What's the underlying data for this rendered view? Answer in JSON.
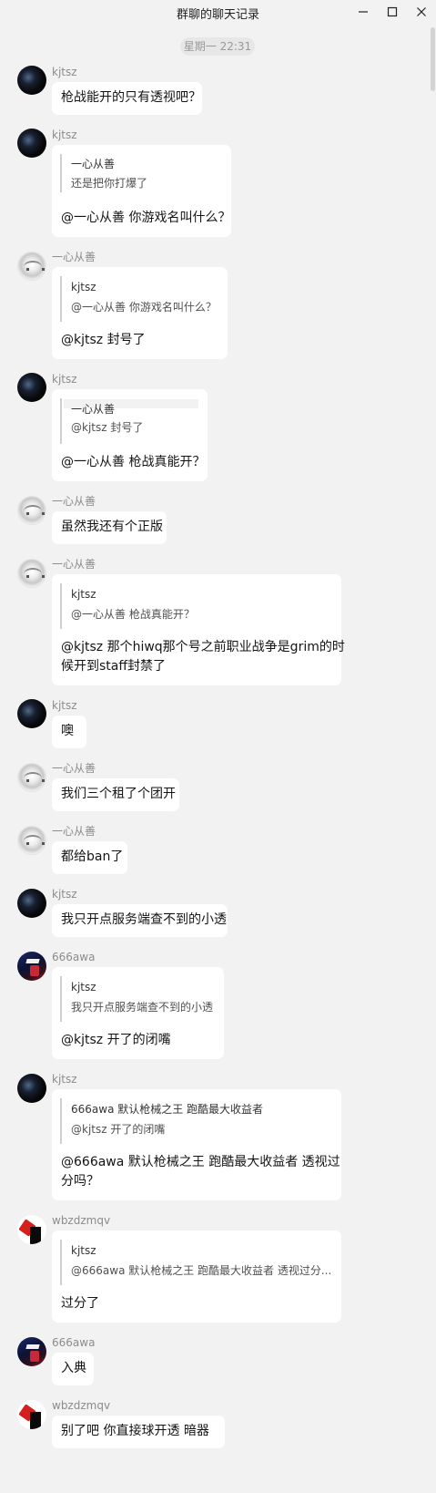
{
  "window": {
    "title": "群聊的聊天记录",
    "minimize_glyph": "minimize-icon",
    "maximize_glyph": "maximize-icon",
    "close_glyph": "close-icon"
  },
  "timestamp": "星期一 22:31",
  "messages": [
    {
      "sender": "kjtsz",
      "avatar": "dark-space-avatar",
      "text": "枪战能开的只有透视吧？"
    },
    {
      "sender": "kjtsz",
      "avatar": "dark-space-avatar",
      "quote": {
        "author": "一心从善",
        "text": "还是把你打爆了"
      },
      "text": "@一心从善 你游戏名叫什么？"
    },
    {
      "sender": "一心从善",
      "avatar": "anime-avatar",
      "quote": {
        "author": "kjtsz",
        "text": "@一心从善 你游戏名叫什么？"
      },
      "text": "@kjtsz 封号了"
    },
    {
      "sender": "kjtsz",
      "avatar": "dark-space-avatar",
      "quote": {
        "author": "一心从善",
        "text": "@kjtsz 封号了"
      },
      "text": "@一心从善 枪战真能开？"
    },
    {
      "sender": "一心从善",
      "avatar": "anime-avatar",
      "text": "虽然我还有个正版"
    },
    {
      "sender": "一心从善",
      "avatar": "anime-avatar",
      "quote": {
        "author": "kjtsz",
        "text": "@一心从善 枪战真能开？"
      },
      "text_lines": [
        "@kjtsz 那个hiwq那个号之前职业战争是grim的时",
        "候开到staff封禁了"
      ]
    },
    {
      "sender": "kjtsz",
      "avatar": "dark-space-avatar",
      "text": "噢"
    },
    {
      "sender": "一心从善",
      "avatar": "anime-avatar",
      "text": "我们三个租了个团开"
    },
    {
      "sender": "一心从善",
      "avatar": "anime-avatar",
      "text": "都给ban了"
    },
    {
      "sender": "kjtsz",
      "avatar": "dark-space-avatar",
      "text": "我只开点服务端查不到的小透"
    },
    {
      "sender": "666awa",
      "avatar": "game-avatar",
      "quote": {
        "author": "kjtsz",
        "text": "我只开点服务端查不到的小透"
      },
      "text": "@kjtsz 开了的闭嘴"
    },
    {
      "sender": "kjtsz",
      "avatar": "dark-space-avatar",
      "quote": {
        "author": "666awa 默认枪械之王 跑酷最大收益者",
        "text": "@kjtsz 开了的闭嘴"
      },
      "text_lines": [
        "@666awa 默认枪械之王 跑酷最大收益者 透视过",
        "分吗？"
      ]
    },
    {
      "sender": "wbzdzmqv",
      "avatar": "red-black-avatar",
      "quote": {
        "author": "kjtsz",
        "text": "@666awa 默认枪械之王 跑酷最大收益者 透视过分..."
      },
      "text": "过分了"
    },
    {
      "sender": "666awa",
      "avatar": "game-avatar",
      "text": "入典"
    },
    {
      "sender": "wbzdzmqv",
      "avatar": "red-black-avatar",
      "text": "别了吧 你直接球开透 暗器"
    }
  ]
}
